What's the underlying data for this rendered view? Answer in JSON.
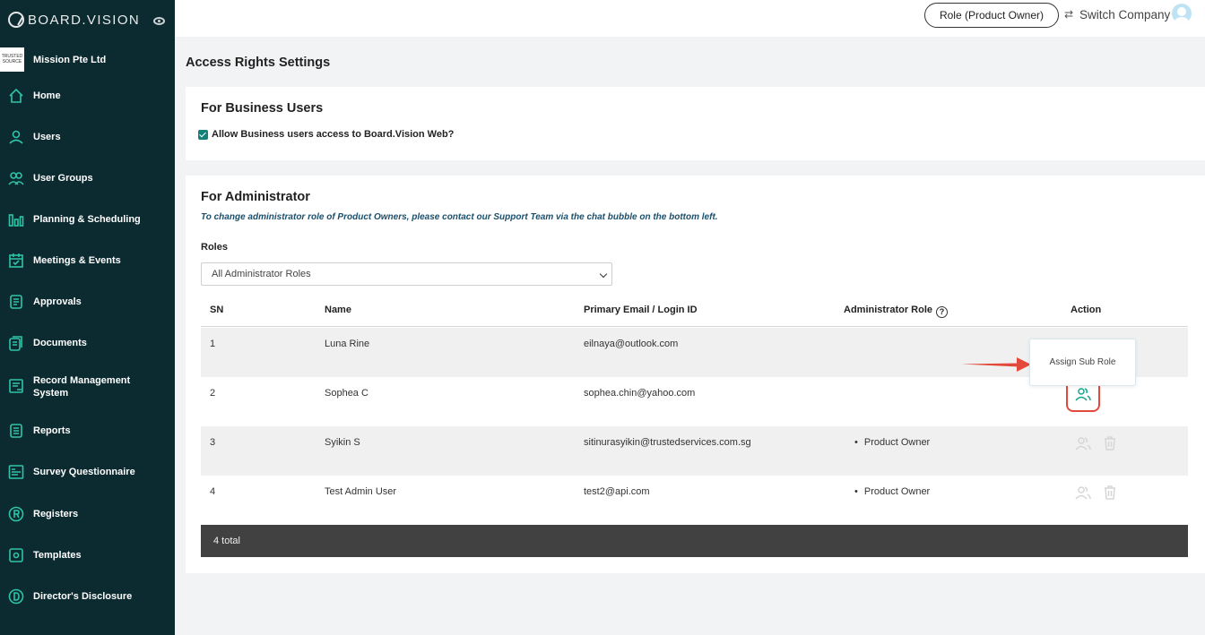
{
  "app": {
    "logo_text": "BOARD.VISION"
  },
  "company": {
    "logo_text": "TRUSTED SOURCE",
    "name": "Mission Pte Ltd"
  },
  "sidebar": {
    "items": [
      {
        "label": "Home",
        "icon": "home-icon"
      },
      {
        "label": "Users",
        "icon": "user-icon"
      },
      {
        "label": "User Groups",
        "icon": "user-groups-icon"
      },
      {
        "label": "Planning & Scheduling",
        "icon": "bar-chart-icon"
      },
      {
        "label": "Meetings & Events",
        "icon": "calendar-icon"
      },
      {
        "label": "Approvals",
        "icon": "approval-doc-icon"
      },
      {
        "label": "Documents",
        "icon": "documents-icon"
      },
      {
        "label": "Record Management System",
        "icon": "record-icon"
      },
      {
        "label": "Reports",
        "icon": "report-icon"
      },
      {
        "label": "Survey Questionnaire",
        "icon": "survey-icon"
      },
      {
        "label": "Registers",
        "icon": "registered-icon"
      },
      {
        "label": "Templates",
        "icon": "template-icon"
      },
      {
        "label": "Director's Disclosure",
        "icon": "disclosure-icon"
      }
    ]
  },
  "header": {
    "role_label": "Role (Product Owner)",
    "switch_label": "Switch Company"
  },
  "page": {
    "title": "Access Rights Settings"
  },
  "business": {
    "heading": "For Business Users",
    "checkbox_label": "Allow Business users access to Board.Vision Web?",
    "checked": true
  },
  "admin": {
    "heading": "For Administrator",
    "note": "To change administrator role of Product Owners, please contact our Support Team via the chat bubble on the bottom left.",
    "roles_label": "Roles",
    "roles_selected": "All Administrator Roles",
    "columns": {
      "sn": "SN",
      "name": "Name",
      "email": "Primary Email / Login ID",
      "role": "Administrator Role",
      "action": "Action"
    },
    "rows": [
      {
        "sn": "1",
        "name": "Luna Rine",
        "email": "eilnaya@outlook.com",
        "role": ""
      },
      {
        "sn": "2",
        "name": "Sophea C",
        "email": "sophea.chin@yahoo.com",
        "role": ""
      },
      {
        "sn": "3",
        "name": "Syikin S",
        "email": "sitinurasyikin@trustedservices.com.sg",
        "role": "Product Owner"
      },
      {
        "sn": "4",
        "name": "Test Admin User",
        "email": "test2@api.com",
        "role": "Product Owner"
      }
    ],
    "total_label": "4 total",
    "tooltip": "Assign Sub Role"
  },
  "colors": {
    "sidebar": "#0c2b31",
    "accent": "#2ec4a7",
    "highlight": "#e2493b"
  }
}
